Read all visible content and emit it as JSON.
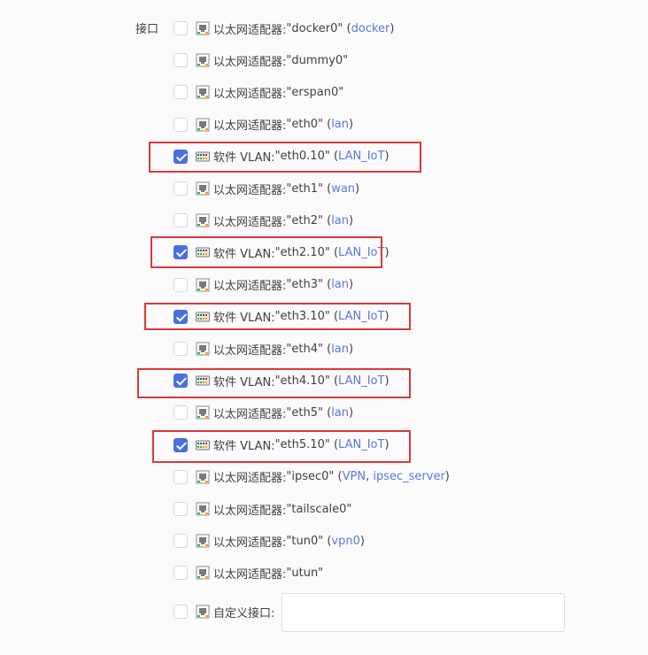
{
  "section_label": "接口",
  "items": [
    {
      "prefix": "以太网适配器:",
      "name": "\"docker0\"",
      "open": "(",
      "nets": [
        "docker"
      ],
      "close": ")",
      "checked": false,
      "icon": "ethernet-port-icon"
    },
    {
      "prefix": "以太网适配器:",
      "name": "\"dummy0\"",
      "open": "",
      "nets": [],
      "close": "",
      "checked": false,
      "icon": "ethernet-port-icon"
    },
    {
      "prefix": "以太网适配器:",
      "name": "\"erspan0\"",
      "open": "",
      "nets": [],
      "close": "",
      "checked": false,
      "icon": "ethernet-port-icon"
    },
    {
      "prefix": "以太网适配器:",
      "name": "\"eth0\"",
      "open": "(",
      "nets": [
        "lan"
      ],
      "close": ")",
      "checked": false,
      "icon": "ethernet-port-icon"
    },
    {
      "prefix": "软件 VLAN:",
      "name": "\"eth0.10\"",
      "open": "(",
      "nets": [
        "LAN_IoT"
      ],
      "close": ")",
      "checked": true,
      "icon": "vlan-switch-icon"
    },
    {
      "prefix": "以太网适配器:",
      "name": "\"eth1\"",
      "open": "(",
      "nets": [
        "wan"
      ],
      "close": ")",
      "checked": false,
      "icon": "ethernet-port-icon"
    },
    {
      "prefix": "以太网适配器:",
      "name": "\"eth2\"",
      "open": "(",
      "nets": [
        "lan"
      ],
      "close": ")",
      "checked": false,
      "icon": "ethernet-port-icon"
    },
    {
      "prefix": "软件 VLAN:",
      "name": "\"eth2.10\"",
      "open": "(",
      "nets": [
        "LAN_IoT"
      ],
      "close": ")",
      "checked": true,
      "icon": "vlan-switch-icon"
    },
    {
      "prefix": "以太网适配器:",
      "name": "\"eth3\"",
      "open": "(",
      "nets": [
        "lan"
      ],
      "close": ")",
      "checked": false,
      "icon": "ethernet-port-icon"
    },
    {
      "prefix": "软件 VLAN:",
      "name": "\"eth3.10\"",
      "open": "(",
      "nets": [
        "LAN_IoT"
      ],
      "close": ")",
      "checked": true,
      "icon": "vlan-switch-icon"
    },
    {
      "prefix": "以太网适配器:",
      "name": "\"eth4\"",
      "open": "(",
      "nets": [
        "lan"
      ],
      "close": ")",
      "checked": false,
      "icon": "ethernet-port-icon"
    },
    {
      "prefix": "软件 VLAN:",
      "name": "\"eth4.10\"",
      "open": "(",
      "nets": [
        "LAN_IoT"
      ],
      "close": ")",
      "checked": true,
      "icon": "vlan-switch-icon"
    },
    {
      "prefix": "以太网适配器:",
      "name": "\"eth5\"",
      "open": "(",
      "nets": [
        "lan"
      ],
      "close": ")",
      "checked": false,
      "icon": "ethernet-port-icon"
    },
    {
      "prefix": "软件 VLAN:",
      "name": "\"eth5.10\"",
      "open": "(",
      "nets": [
        "LAN_IoT"
      ],
      "close": ")",
      "checked": true,
      "icon": "vlan-switch-icon"
    },
    {
      "prefix": "以太网适配器:",
      "name": "\"ipsec0\"",
      "open": "(",
      "nets": [
        "VPN",
        "ipsec_server"
      ],
      "close": ")",
      "checked": false,
      "icon": "ethernet-port-icon"
    },
    {
      "prefix": "以太网适配器:",
      "name": "\"tailscale0\"",
      "open": "",
      "nets": [],
      "close": "",
      "checked": false,
      "icon": "ethernet-port-icon"
    },
    {
      "prefix": "以太网适配器:",
      "name": "\"tun0\"",
      "open": "(",
      "nets": [
        "vpn0"
      ],
      "close": ")",
      "checked": false,
      "icon": "ethernet-port-icon"
    },
    {
      "prefix": "以太网适配器:",
      "name": "\"utun\"",
      "open": "",
      "nets": [],
      "close": "",
      "checked": false,
      "icon": "ethernet-port-icon"
    }
  ],
  "custom": {
    "label": "自定义接口:",
    "value": "",
    "checked": false,
    "icon": "ethernet-port-icon"
  },
  "colors": {
    "accent": "#4a6fe3",
    "link": "#5b78d9",
    "highlight": "#d63a3a"
  }
}
